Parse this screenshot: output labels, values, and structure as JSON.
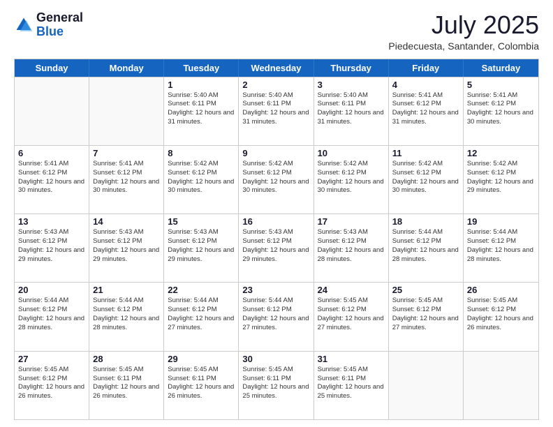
{
  "logo": {
    "general": "General",
    "blue": "Blue"
  },
  "title": {
    "month_year": "July 2025",
    "location": "Piedecuesta, Santander, Colombia"
  },
  "days_of_week": [
    "Sunday",
    "Monday",
    "Tuesday",
    "Wednesday",
    "Thursday",
    "Friday",
    "Saturday"
  ],
  "weeks": [
    [
      {
        "day": "",
        "info": ""
      },
      {
        "day": "",
        "info": ""
      },
      {
        "day": "1",
        "info": "Sunrise: 5:40 AM\nSunset: 6:11 PM\nDaylight: 12 hours and 31 minutes."
      },
      {
        "day": "2",
        "info": "Sunrise: 5:40 AM\nSunset: 6:11 PM\nDaylight: 12 hours and 31 minutes."
      },
      {
        "day": "3",
        "info": "Sunrise: 5:40 AM\nSunset: 6:11 PM\nDaylight: 12 hours and 31 minutes."
      },
      {
        "day": "4",
        "info": "Sunrise: 5:41 AM\nSunset: 6:12 PM\nDaylight: 12 hours and 31 minutes."
      },
      {
        "day": "5",
        "info": "Sunrise: 5:41 AM\nSunset: 6:12 PM\nDaylight: 12 hours and 30 minutes."
      }
    ],
    [
      {
        "day": "6",
        "info": "Sunrise: 5:41 AM\nSunset: 6:12 PM\nDaylight: 12 hours and 30 minutes."
      },
      {
        "day": "7",
        "info": "Sunrise: 5:41 AM\nSunset: 6:12 PM\nDaylight: 12 hours and 30 minutes."
      },
      {
        "day": "8",
        "info": "Sunrise: 5:42 AM\nSunset: 6:12 PM\nDaylight: 12 hours and 30 minutes."
      },
      {
        "day": "9",
        "info": "Sunrise: 5:42 AM\nSunset: 6:12 PM\nDaylight: 12 hours and 30 minutes."
      },
      {
        "day": "10",
        "info": "Sunrise: 5:42 AM\nSunset: 6:12 PM\nDaylight: 12 hours and 30 minutes."
      },
      {
        "day": "11",
        "info": "Sunrise: 5:42 AM\nSunset: 6:12 PM\nDaylight: 12 hours and 30 minutes."
      },
      {
        "day": "12",
        "info": "Sunrise: 5:42 AM\nSunset: 6:12 PM\nDaylight: 12 hours and 29 minutes."
      }
    ],
    [
      {
        "day": "13",
        "info": "Sunrise: 5:43 AM\nSunset: 6:12 PM\nDaylight: 12 hours and 29 minutes."
      },
      {
        "day": "14",
        "info": "Sunrise: 5:43 AM\nSunset: 6:12 PM\nDaylight: 12 hours and 29 minutes."
      },
      {
        "day": "15",
        "info": "Sunrise: 5:43 AM\nSunset: 6:12 PM\nDaylight: 12 hours and 29 minutes."
      },
      {
        "day": "16",
        "info": "Sunrise: 5:43 AM\nSunset: 6:12 PM\nDaylight: 12 hours and 29 minutes."
      },
      {
        "day": "17",
        "info": "Sunrise: 5:43 AM\nSunset: 6:12 PM\nDaylight: 12 hours and 28 minutes."
      },
      {
        "day": "18",
        "info": "Sunrise: 5:44 AM\nSunset: 6:12 PM\nDaylight: 12 hours and 28 minutes."
      },
      {
        "day": "19",
        "info": "Sunrise: 5:44 AM\nSunset: 6:12 PM\nDaylight: 12 hours and 28 minutes."
      }
    ],
    [
      {
        "day": "20",
        "info": "Sunrise: 5:44 AM\nSunset: 6:12 PM\nDaylight: 12 hours and 28 minutes."
      },
      {
        "day": "21",
        "info": "Sunrise: 5:44 AM\nSunset: 6:12 PM\nDaylight: 12 hours and 28 minutes."
      },
      {
        "day": "22",
        "info": "Sunrise: 5:44 AM\nSunset: 6:12 PM\nDaylight: 12 hours and 27 minutes."
      },
      {
        "day": "23",
        "info": "Sunrise: 5:44 AM\nSunset: 6:12 PM\nDaylight: 12 hours and 27 minutes."
      },
      {
        "day": "24",
        "info": "Sunrise: 5:45 AM\nSunset: 6:12 PM\nDaylight: 12 hours and 27 minutes."
      },
      {
        "day": "25",
        "info": "Sunrise: 5:45 AM\nSunset: 6:12 PM\nDaylight: 12 hours and 27 minutes."
      },
      {
        "day": "26",
        "info": "Sunrise: 5:45 AM\nSunset: 6:12 PM\nDaylight: 12 hours and 26 minutes."
      }
    ],
    [
      {
        "day": "27",
        "info": "Sunrise: 5:45 AM\nSunset: 6:12 PM\nDaylight: 12 hours and 26 minutes."
      },
      {
        "day": "28",
        "info": "Sunrise: 5:45 AM\nSunset: 6:11 PM\nDaylight: 12 hours and 26 minutes."
      },
      {
        "day": "29",
        "info": "Sunrise: 5:45 AM\nSunset: 6:11 PM\nDaylight: 12 hours and 26 minutes."
      },
      {
        "day": "30",
        "info": "Sunrise: 5:45 AM\nSunset: 6:11 PM\nDaylight: 12 hours and 25 minutes."
      },
      {
        "day": "31",
        "info": "Sunrise: 5:45 AM\nSunset: 6:11 PM\nDaylight: 12 hours and 25 minutes."
      },
      {
        "day": "",
        "info": ""
      },
      {
        "day": "",
        "info": ""
      }
    ]
  ]
}
